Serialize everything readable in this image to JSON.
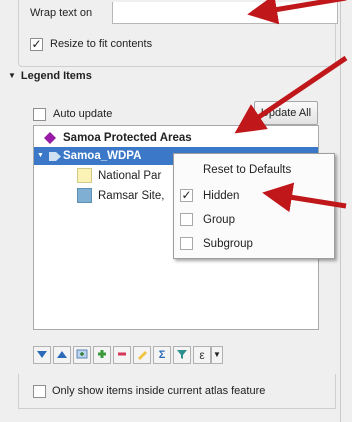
{
  "wrap": {
    "label": "Wrap text on",
    "value": ""
  },
  "resize": {
    "label": "Resize to fit contents",
    "checked": "✓"
  },
  "legend": {
    "title": "Legend Items",
    "auto_update_label": "Auto update",
    "update_all_label": "Update All",
    "tree": [
      {
        "label": "Samoa Protected Areas",
        "symbol": "diamond",
        "color": "#9a1aa8"
      },
      {
        "label": "Samoa_WDPA",
        "symbol": "group-arrow",
        "selected": true
      },
      {
        "label": "National Par",
        "symbol": "square",
        "color": "#fbf3b6"
      },
      {
        "label": "Ramsar Site,",
        "symbol": "square",
        "color": "#7fb0d4"
      }
    ]
  },
  "context_menu": {
    "reset_label": "Reset to Defaults",
    "hidden_label": "Hidden",
    "hidden_check": "✓",
    "group_label": "Group",
    "subgroup_label": "Subgroup"
  },
  "toolbar": {
    "buttons": [
      "move-down-icon",
      "move-up-icon",
      "add-group-icon",
      "add-item-icon",
      "remove-item-icon",
      "edit-icon",
      "sum-icon",
      "filter-icon",
      "expression-icon",
      "dropdown-icon"
    ],
    "sum_glyph": "Σ",
    "expr_glyph": "ε"
  },
  "atlas": {
    "label": "Only show items inside current atlas feature"
  },
  "colors": {
    "selection": "#3b78c8",
    "arrow": "#c0171b",
    "diamond": "#9a1aa8"
  }
}
